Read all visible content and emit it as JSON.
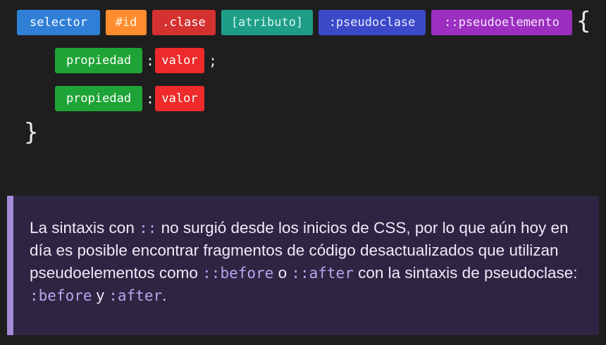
{
  "syntax": {
    "selector": "selector",
    "id": "#id",
    "clase": ".clase",
    "atributo": "[atributo]",
    "pseudoclase": ":pseudoclase",
    "pseudoelemento": "::pseudoelemento",
    "open_brace": "{",
    "close_brace": "}",
    "declarations": [
      {
        "property": "propiedad",
        "colon": ":",
        "value": "valor",
        "terminator": ";"
      },
      {
        "property": "propiedad",
        "colon": ":",
        "value": "valor",
        "terminator": ""
      }
    ]
  },
  "note": {
    "t1": "La sintaxis con ",
    "c1": "::",
    "t2": " no surgió desde los inicios de CSS, por lo que aún hoy en día es posible encontrar fragmentos de código desactualizados que utilizan pseudoelementos como ",
    "c2": "::before",
    "t3": " o ",
    "c3": "::after",
    "t4": " con la sintaxis de pseudoclase: ",
    "c4": ":before",
    "t5": " y ",
    "c5": ":after",
    "t6": "."
  },
  "colors": {
    "selector": "#2f7fd6",
    "id": "#ff8c2e",
    "clase": "#d63131",
    "atributo": "#1e9e87",
    "pseudoclase": "#3b49c8",
    "pseudoelemento": "#9c2fbf",
    "propiedad": "#1ea336",
    "valor": "#ee2a2a",
    "note_background": "#2d2541",
    "note_accent": "#a78bd6"
  }
}
